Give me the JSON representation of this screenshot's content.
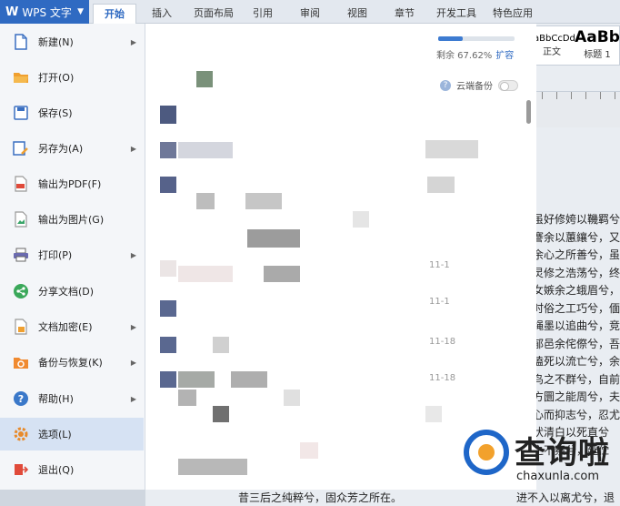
{
  "app": {
    "title": "WPS 文字"
  },
  "tabs": [
    {
      "label": "开始",
      "active": true
    },
    {
      "label": "插入"
    },
    {
      "label": "页面布局"
    },
    {
      "label": "引用"
    },
    {
      "label": "审阅"
    },
    {
      "label": "视图"
    },
    {
      "label": "章节"
    },
    {
      "label": "开发工具"
    },
    {
      "label": "特色应用"
    }
  ],
  "styles": [
    {
      "preview": "aBbCcDd",
      "label": "正文"
    },
    {
      "preview": "AaBb",
      "label": "标题 1"
    }
  ],
  "file_menu": [
    {
      "label": "新建(N)",
      "icon": "new-doc-icon",
      "submenu": true
    },
    {
      "label": "打开(O)",
      "icon": "open-folder-icon",
      "submenu": false
    },
    {
      "label": "保存(S)",
      "icon": "save-icon",
      "submenu": false
    },
    {
      "label": "另存为(A)",
      "icon": "save-as-icon",
      "submenu": true
    },
    {
      "label": "输出为PDF(F)",
      "icon": "pdf-icon",
      "submenu": false
    },
    {
      "label": "输出为图片(G)",
      "icon": "image-export-icon",
      "submenu": false
    },
    {
      "label": "打印(P)",
      "icon": "print-icon",
      "submenu": true
    },
    {
      "label": "分享文档(D)",
      "icon": "share-icon",
      "submenu": false
    },
    {
      "label": "文档加密(E)",
      "icon": "lock-icon",
      "submenu": true
    },
    {
      "label": "备份与恢复(K)",
      "icon": "backup-icon",
      "submenu": true
    },
    {
      "label": "帮助(H)",
      "icon": "help-icon",
      "submenu": true
    },
    {
      "label": "选项(L)",
      "icon": "gear-icon",
      "submenu": false,
      "selected": true
    },
    {
      "label": "退出(Q)",
      "icon": "exit-icon",
      "submenu": false
    }
  ],
  "cloud": {
    "remaining_label": "剩余 67.62%",
    "remaining_percent": 32.38,
    "expand_label": "扩容",
    "backup_label": "云端备份"
  },
  "recent": {
    "dates": [
      "11-1",
      "11-1",
      "11-18",
      "11-18"
    ]
  },
  "document": {
    "lines": [
      "虽好修姱以鞿羁兮",
      "謇余以蕙纕兮，又",
      "余心之所善兮，虽",
      "灵修之浩荡兮，终",
      "女嫉余之蛾眉兮，",
      "时俗之工巧兮，偭",
      "绳墨以追曲兮，竞",
      "郁邑余侘傺兮，吾",
      "溘死以流亡兮，余",
      "鸟之不群兮，自前",
      "方圜之能周兮，夫",
      "心而抑志兮，忍尤",
      "伏清白以死直兮",
      "之不察兮，延伫"
    ],
    "bottom_left": "昔三后之纯粹兮，固众芳之所在。",
    "bottom_right": "进不入以离尤兮，退"
  },
  "watermark": {
    "text": "查询啦",
    "url": "chaxunla.com"
  }
}
